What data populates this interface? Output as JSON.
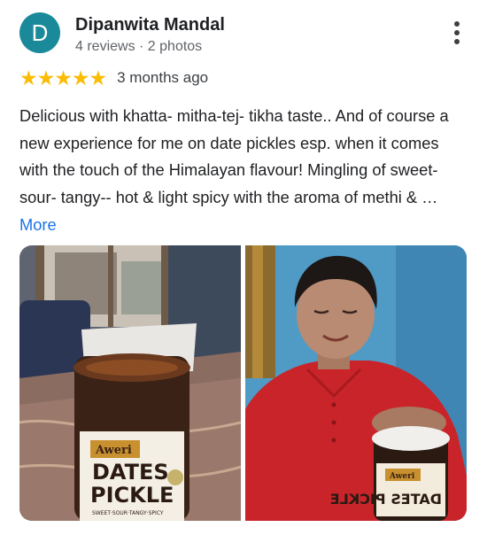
{
  "reviewer": {
    "initial": "D",
    "name": "Dipanwita Mandal",
    "meta": "4 reviews · 2 photos",
    "avatar_color": "#1a8a9a"
  },
  "rating": {
    "stars": "★★★★★",
    "value": 5,
    "date": "3 months ago",
    "star_color": "#fbbc04"
  },
  "review": {
    "text": "Delicious with khatta- mitha-tej- tikha taste.. And of course a new experience for me on date pickles esp. when it comes with the touch of the Himalayan flavour! Mingling of sweet- sour- tangy-- hot & light spicy with the aroma of methi & …",
    "more_label": "More"
  },
  "photos": [
    {
      "brand": "Aweri",
      "line1": "DATES",
      "line2": "PICKLE",
      "tagline": "SWEET·SOUR·TANGY·SPICY"
    },
    {
      "brand": "Aweri",
      "mirrored_label": "DATES PICKLE"
    }
  ],
  "menu_icon": "more-vert-icon"
}
